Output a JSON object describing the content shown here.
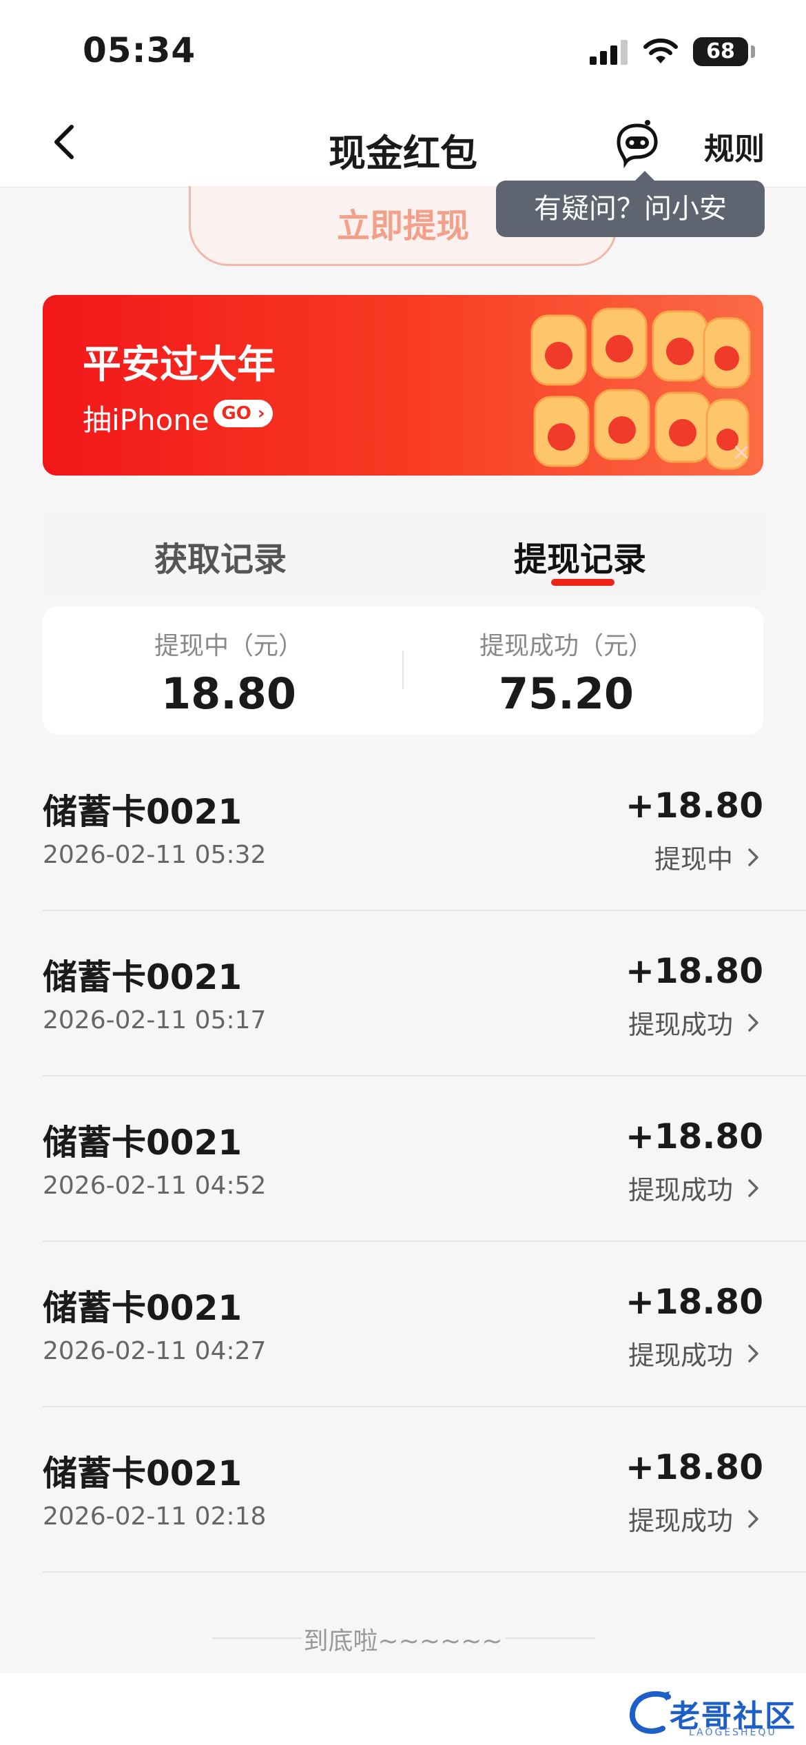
{
  "status_bar": {
    "time": "05:34",
    "battery": "68"
  },
  "nav": {
    "title": "现金红包",
    "rules_label": "规则"
  },
  "withdraw_button_label": "立即提现",
  "tooltip": "有疑问？问小安",
  "banner": {
    "title": "平安过大年",
    "subtitle": "抽iPhone",
    "go_label": "GO ›",
    "close_label": "×"
  },
  "tabs": [
    {
      "label": "获取记录",
      "active": false
    },
    {
      "label": "提现记录",
      "active": true
    }
  ],
  "summary": {
    "pending_label": "提现中（元）",
    "pending_value": "18.80",
    "success_label": "提现成功（元）",
    "success_value": "75.20"
  },
  "records": [
    {
      "name": "储蓄卡0021",
      "time": "2026-02-11 05:32",
      "amount": "+18.80",
      "status": "提现中"
    },
    {
      "name": "储蓄卡0021",
      "time": "2026-02-11 05:17",
      "amount": "+18.80",
      "status": "提现成功"
    },
    {
      "name": "储蓄卡0021",
      "time": "2026-02-11 04:52",
      "amount": "+18.80",
      "status": "提现成功"
    },
    {
      "name": "储蓄卡0021",
      "time": "2026-02-11 04:27",
      "amount": "+18.80",
      "status": "提现成功"
    },
    {
      "name": "储蓄卡0021",
      "time": "2026-02-11 02:18",
      "amount": "+18.80",
      "status": "提现成功"
    }
  ],
  "footer_text": "到底啦~~~~~~",
  "watermark": {
    "text": "老哥社区",
    "sub": "LAOGESHEQU"
  },
  "colors": {
    "accent": "#ef2416",
    "banner_start": "#f2171a",
    "banner_end": "#fb6b46",
    "tooltip_bg": "#5e6470"
  }
}
